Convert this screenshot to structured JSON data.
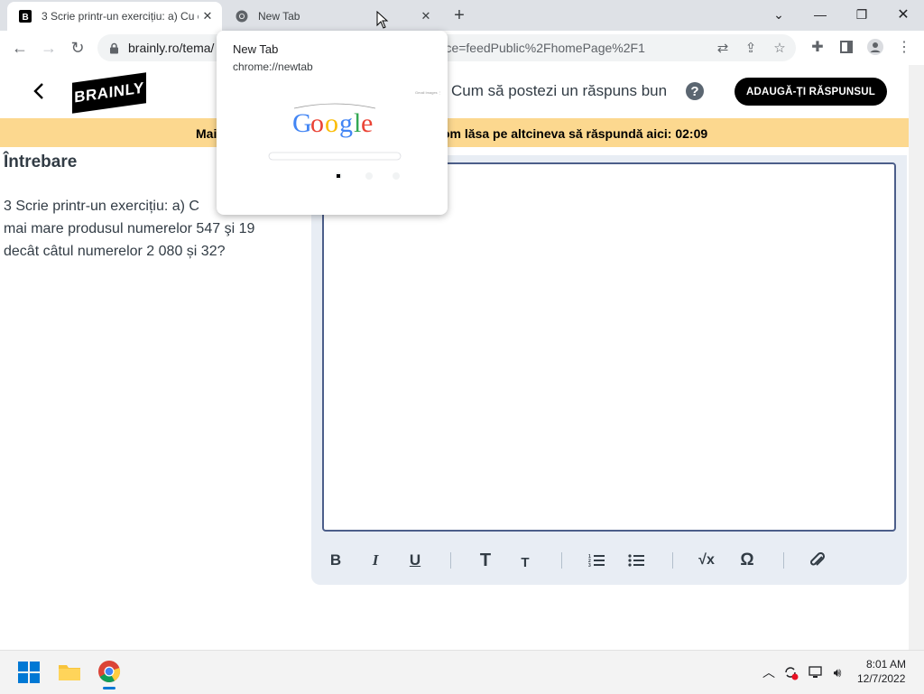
{
  "browser": {
    "tabs": [
      {
        "title": "3 Scrie printr-un exercițiu: a) Cu c",
        "active": true
      },
      {
        "title": "New Tab",
        "active": false
      }
    ],
    "url_visible": "brainly.ro/tema/",
    "url_visible_tail": "urce=feedPublic%2FhomePage%2F1"
  },
  "hovercard": {
    "title": "New Tab",
    "url": "chrome://newtab"
  },
  "site": {
    "logo_text": "BRAINLY",
    "how_to_link": "Cum să postezi un răspuns bun",
    "add_answer_button": "ADAUGĂ-ȚI RĂSPUNSUL",
    "banner_left": "Mai",
    "banner_right": "om lăsa pe altcineva să răspundă aici: 02:09"
  },
  "question": {
    "heading": "Întrebare",
    "text_line1": "3 Scrie printr-un exercițiu: a) C",
    "text_line2": "mai mare produsul numerelor 547 şi 19",
    "text_line3": "decât câtul numerelor 2 080 și 32?"
  },
  "editor": {
    "toolbar": {
      "bold": "B",
      "italic": "I",
      "underline": "U",
      "heading_large": "T",
      "heading_small": "T",
      "sqrt": "√x",
      "omega": "Ω"
    }
  },
  "taskbar": {
    "time": "8:01 AM",
    "date": "12/7/2022"
  },
  "colors": {
    "banner": "#fcd88f",
    "editor_border": "#4c5e8a",
    "tab_strip": "#dee1e6"
  }
}
